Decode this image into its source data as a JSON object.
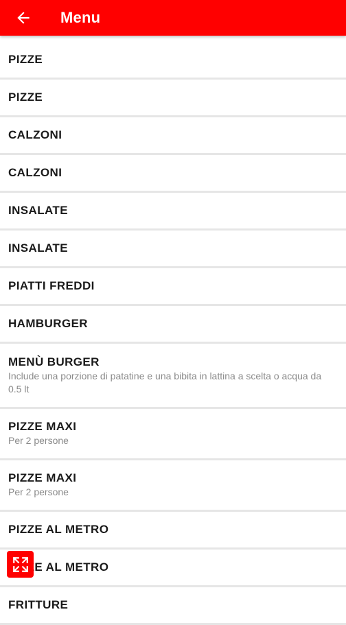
{
  "colors": {
    "app_bar": "#ff0000",
    "divider": "#e6e6e6",
    "label": "#1a1a1a",
    "description": "#8a8a8a"
  },
  "app_bar": {
    "back_icon": "arrow-left-icon",
    "title": "Menu"
  },
  "menu": {
    "items": [
      {
        "label": "PIZZE",
        "description": ""
      },
      {
        "label": "PIZZE",
        "description": ""
      },
      {
        "label": "CALZONI",
        "description": ""
      },
      {
        "label": "CALZONI",
        "description": ""
      },
      {
        "label": "INSALATE",
        "description": ""
      },
      {
        "label": "INSALATE",
        "description": ""
      },
      {
        "label": "PIATTI FREDDI",
        "description": ""
      },
      {
        "label": "HAMBURGER",
        "description": ""
      },
      {
        "label": "MENÙ BURGER",
        "description": "Include una porzione di patatine e una bibita in lattina a scelta o acqua da 0.5 lt"
      },
      {
        "label": "PIZZE MAXI",
        "description": "Per 2 persone"
      },
      {
        "label": "PIZZE MAXI",
        "description": "Per 2 persone"
      },
      {
        "label": "PIZZE AL METRO",
        "description": ""
      },
      {
        "label": "PIZZE AL METRO",
        "description": ""
      },
      {
        "label": "FRITTURE",
        "description": ""
      }
    ]
  },
  "floating_button": {
    "icon": "expand-icon"
  }
}
